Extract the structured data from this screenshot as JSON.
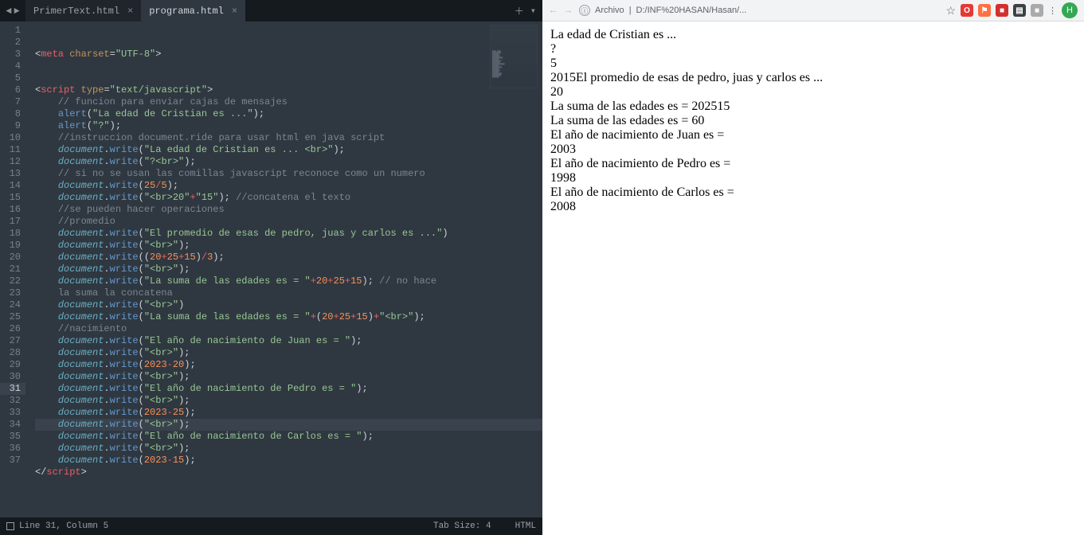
{
  "tabs": [
    {
      "label": "PrimerText.html",
      "active": false
    },
    {
      "label": "programa.html",
      "active": true
    }
  ],
  "code_lines": [
    {
      "n": 1,
      "html": "<span class='tk-punc'>&lt;</span><span class='tk-tag'>meta</span> <span class='tk-attr'>charset</span><span class='tk-punc'>=</span><span class='tk-str'>\"UTF-8\"</span><span class='tk-punc'>&gt;</span>"
    },
    {
      "n": 2,
      "html": ""
    },
    {
      "n": 3,
      "html": ""
    },
    {
      "n": 4,
      "html": "<span class='tk-punc'>&lt;</span><span class='tk-tag'>script</span> <span class='tk-attr'>type</span><span class='tk-punc'>=</span><span class='tk-str'>\"text/javascript\"</span><span class='tk-punc'>&gt;</span>"
    },
    {
      "n": 5,
      "html": "    <span class='tk-comment'>// funcion para enviar cajas de mensajes</span>"
    },
    {
      "n": 6,
      "html": "    <span class='tk-func'>alert</span><span class='tk-punc'>(</span><span class='tk-str'>\"La edad de Cristian es ...\"</span><span class='tk-punc'>);</span>"
    },
    {
      "n": 7,
      "html": "    <span class='tk-func'>alert</span><span class='tk-punc'>(</span><span class='tk-str'>\"?\"</span><span class='tk-punc'>);</span>"
    },
    {
      "n": 8,
      "html": "    <span class='tk-comment'>//instruccion document.ride para usar html en java script</span>"
    },
    {
      "n": 9,
      "html": "    <span class='tk-obj'>document</span><span class='tk-punc'>.</span><span class='tk-func'>write</span><span class='tk-punc'>(</span><span class='tk-str'>\"La edad de Cristian es ... &lt;br&gt;\"</span><span class='tk-punc'>);</span>"
    },
    {
      "n": 10,
      "html": "    <span class='tk-obj'>document</span><span class='tk-punc'>.</span><span class='tk-func'>write</span><span class='tk-punc'>(</span><span class='tk-str'>\"?&lt;br&gt;\"</span><span class='tk-punc'>);</span>"
    },
    {
      "n": 11,
      "html": "    <span class='tk-comment'>// si no se usan las comillas javascript reconoce como un numero</span>"
    },
    {
      "n": 12,
      "html": "    <span class='tk-obj'>document</span><span class='tk-punc'>.</span><span class='tk-func'>write</span><span class='tk-punc'>(</span><span class='tk-num'>25</span><span class='tk-op'>/</span><span class='tk-num'>5</span><span class='tk-punc'>);</span>"
    },
    {
      "n": 13,
      "html": "    <span class='tk-obj'>document</span><span class='tk-punc'>.</span><span class='tk-func'>write</span><span class='tk-punc'>(</span><span class='tk-str'>\"&lt;br&gt;20\"</span><span class='tk-op'>+</span><span class='tk-str'>\"15\"</span><span class='tk-punc'>);</span> <span class='tk-comment'>//concatena el texto</span>"
    },
    {
      "n": 14,
      "html": "    <span class='tk-comment'>//se pueden hacer operaciones</span>"
    },
    {
      "n": 15,
      "html": "    <span class='tk-comment'>//promedio</span>"
    },
    {
      "n": 16,
      "html": "    <span class='tk-obj'>document</span><span class='tk-punc'>.</span><span class='tk-func'>write</span><span class='tk-punc'>(</span><span class='tk-str'>\"El promedio de esas de pedro, juas y carlos es ...\"</span><span class='tk-punc'>)</span>"
    },
    {
      "n": 17,
      "html": "    <span class='tk-obj'>document</span><span class='tk-punc'>.</span><span class='tk-func'>write</span><span class='tk-punc'>(</span><span class='tk-str'>\"&lt;br&gt;\"</span><span class='tk-punc'>);</span>"
    },
    {
      "n": 18,
      "html": "    <span class='tk-obj'>document</span><span class='tk-punc'>.</span><span class='tk-func'>write</span><span class='tk-punc'>((</span><span class='tk-num'>20</span><span class='tk-op'>+</span><span class='tk-num'>25</span><span class='tk-op'>+</span><span class='tk-num'>15</span><span class='tk-punc'>)</span><span class='tk-op'>/</span><span class='tk-num'>3</span><span class='tk-punc'>);</span>"
    },
    {
      "n": 19,
      "html": "    <span class='tk-obj'>document</span><span class='tk-punc'>.</span><span class='tk-func'>write</span><span class='tk-punc'>(</span><span class='tk-str'>\"&lt;br&gt;\"</span><span class='tk-punc'>);</span>"
    },
    {
      "n": 20,
      "html": "    <span class='tk-obj'>document</span><span class='tk-punc'>.</span><span class='tk-func'>write</span><span class='tk-punc'>(</span><span class='tk-str'>\"La suma de las edades es = \"</span><span class='tk-op'>+</span><span class='tk-num'>20</span><span class='tk-op'>+</span><span class='tk-num'>25</span><span class='tk-op'>+</span><span class='tk-num'>15</span><span class='tk-punc'>);</span> <span class='tk-comment'>// no hace</span>"
    },
    {
      "n": " ",
      "html": "    <span class='tk-comment'>la suma la concatena</span>",
      "wrap": true
    },
    {
      "n": 21,
      "html": "    <span class='tk-obj'>document</span><span class='tk-punc'>.</span><span class='tk-func'>write</span><span class='tk-punc'>(</span><span class='tk-str'>\"&lt;br&gt;\"</span><span class='tk-punc'>)</span>"
    },
    {
      "n": 22,
      "html": "    <span class='tk-obj'>document</span><span class='tk-punc'>.</span><span class='tk-func'>write</span><span class='tk-punc'>(</span><span class='tk-str'>\"La suma de las edades es = \"</span><span class='tk-op'>+</span><span class='tk-punc'>(</span><span class='tk-num'>20</span><span class='tk-op'>+</span><span class='tk-num'>25</span><span class='tk-op'>+</span><span class='tk-num'>15</span><span class='tk-punc'>)</span><span class='tk-op'>+</span><span class='tk-str'>\"&lt;br&gt;\"</span><span class='tk-punc'>);</span>"
    },
    {
      "n": 23,
      "html": "    <span class='tk-comment'>//nacimiento</span>"
    },
    {
      "n": 24,
      "html": "    <span class='tk-obj'>document</span><span class='tk-punc'>.</span><span class='tk-func'>write</span><span class='tk-punc'>(</span><span class='tk-str'>\"El año de nacimiento de Juan es = \"</span><span class='tk-punc'>);</span>"
    },
    {
      "n": 25,
      "html": "    <span class='tk-obj'>document</span><span class='tk-punc'>.</span><span class='tk-func'>write</span><span class='tk-punc'>(</span><span class='tk-str'>\"&lt;br&gt;\"</span><span class='tk-punc'>);</span>"
    },
    {
      "n": 26,
      "html": "    <span class='tk-obj'>document</span><span class='tk-punc'>.</span><span class='tk-func'>write</span><span class='tk-punc'>(</span><span class='tk-num'>2023</span><span class='tk-op'>-</span><span class='tk-num'>20</span><span class='tk-punc'>);</span>"
    },
    {
      "n": 27,
      "html": "    <span class='tk-obj'>document</span><span class='tk-punc'>.</span><span class='tk-func'>write</span><span class='tk-punc'>(</span><span class='tk-str'>\"&lt;br&gt;\"</span><span class='tk-punc'>);</span>"
    },
    {
      "n": 28,
      "html": "    <span class='tk-obj'>document</span><span class='tk-punc'>.</span><span class='tk-func'>write</span><span class='tk-punc'>(</span><span class='tk-str'>\"El año de nacimiento de Pedro es = \"</span><span class='tk-punc'>);</span>"
    },
    {
      "n": 29,
      "html": "    <span class='tk-obj'>document</span><span class='tk-punc'>.</span><span class='tk-func'>write</span><span class='tk-punc'>(</span><span class='tk-str'>\"&lt;br&gt;\"</span><span class='tk-punc'>);</span>"
    },
    {
      "n": 30,
      "html": "    <span class='tk-obj'>document</span><span class='tk-punc'>.</span><span class='tk-func'>write</span><span class='tk-punc'>(</span><span class='tk-num'>2023</span><span class='tk-op'>-</span><span class='tk-num'>25</span><span class='tk-punc'>);</span>"
    },
    {
      "n": 31,
      "html": "    <span class='tk-obj'>document</span><span class='tk-punc'>.</span><span class='tk-func'>write</span><span class='tk-punc'>(</span><span class='tk-str'>\"&lt;br&gt;\"</span><span class='tk-punc'>);</span>",
      "active": true
    },
    {
      "n": 32,
      "html": "    <span class='tk-obj'>document</span><span class='tk-punc'>.</span><span class='tk-func'>write</span><span class='tk-punc'>(</span><span class='tk-str'>\"El año de nacimiento de Carlos es = \"</span><span class='tk-punc'>);</span>"
    },
    {
      "n": 33,
      "html": "    <span class='tk-obj'>document</span><span class='tk-punc'>.</span><span class='tk-func'>write</span><span class='tk-punc'>(</span><span class='tk-str'>\"&lt;br&gt;\"</span><span class='tk-punc'>);</span>"
    },
    {
      "n": 34,
      "html": "    <span class='tk-obj'>document</span><span class='tk-punc'>.</span><span class='tk-func'>write</span><span class='tk-punc'>(</span><span class='tk-num'>2023</span><span class='tk-op'>-</span><span class='tk-num'>15</span><span class='tk-punc'>);</span>"
    },
    {
      "n": 35,
      "html": "<span class='tk-punc'>&lt;/</span><span class='tk-tag'>script</span><span class='tk-punc'>&gt;</span>"
    },
    {
      "n": 36,
      "html": ""
    },
    {
      "n": 37,
      "html": ""
    }
  ],
  "status": {
    "cursor": "Line 31, Column 5",
    "tab_size": "Tab Size: 4",
    "lang": "HTML"
  },
  "browser": {
    "addr_label": "Archivo",
    "addr_path": "D:/INF%20HASAN/Hasan/...",
    "ext_icons": [
      "☆",
      "O",
      "⚑",
      "■",
      "▤",
      "■",
      "⋮"
    ],
    "avatar_letter": "H",
    "output_lines": [
      "La edad de Cristian es ...",
      "?",
      "5",
      "2015El promedio de esas de pedro, juas y carlos es ...",
      "20",
      "La suma de las edades es = 202515",
      "La suma de las edades es = 60",
      "El año de nacimiento de Juan es =",
      "2003",
      "El año de nacimiento de Pedro es =",
      "1998",
      "El año de nacimiento de Carlos es =",
      "2008"
    ]
  }
}
